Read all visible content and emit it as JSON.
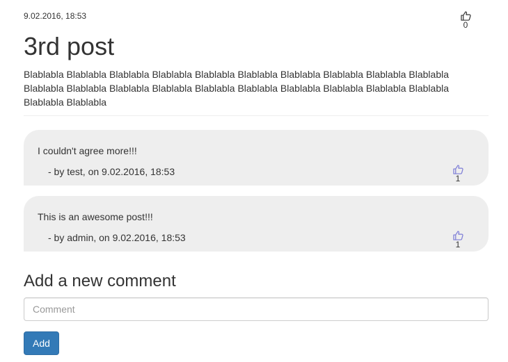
{
  "post": {
    "date": "9.02.2016, 18:53",
    "title": "3rd post",
    "body": "Blablabla Blablabla Blablabla Blablabla Blablabla Blablabla Blablabla Blablabla Blablabla Blablabla Blablabla Blablabla Blablabla Blablabla Blablabla Blablabla Blablabla Blablabla Blablabla Blablabla Blablabla Blablabla",
    "likes": "0",
    "like_icon": "thumbs-up-icon"
  },
  "comments": [
    {
      "text": "I couldn't agree more!!!",
      "meta": "- by test, on 9.02.2016, 18:53",
      "likes": "1"
    },
    {
      "text": "This is an awesome post!!!",
      "meta": "- by admin, on 9.02.2016, 18:53",
      "likes": "1"
    }
  ],
  "new_comment": {
    "heading": "Add a new comment",
    "placeholder": "Comment",
    "value": "",
    "button_label": "Add"
  },
  "colors": {
    "comment_background": "#eeeeee",
    "button_primary": "#337ab7",
    "comment_like_icon": "#7b7bd6",
    "post_like_icon": "#333333"
  }
}
